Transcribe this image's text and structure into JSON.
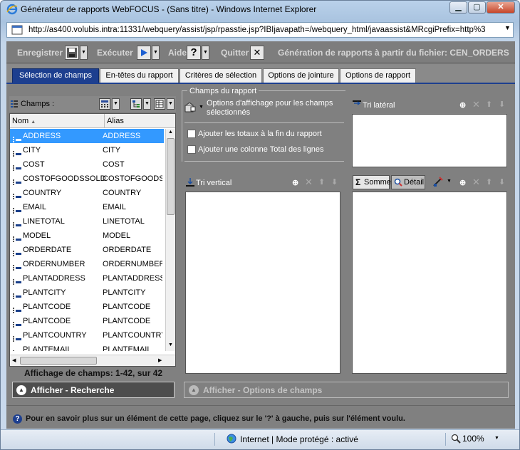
{
  "window": {
    "title": "Générateur de rapports WebFOCUS - (Sans titre) - Windows Internet Explorer",
    "address": "http://as400.volubis.intra:11331/webquery/assist/jsp/rpasstie.jsp?IBIjavapath=/webquery_html/javaassist&MRcgiPrefix=http%3"
  },
  "toolbar": {
    "save_label": "Enregistrer",
    "run_label": "Exécuter",
    "help_label": "Aide",
    "quit_label": "Quitter",
    "report_title": "Génération de rapports à partir du fichier: CEN_ORDERS"
  },
  "tabs": [
    {
      "label": "Sélection de champs",
      "active": true
    },
    {
      "label": "En-têtes du rapport",
      "active": false
    },
    {
      "label": "Critères de sélection",
      "active": false
    },
    {
      "label": "Options de jointure",
      "active": false
    },
    {
      "label": "Options de rapport",
      "active": false
    }
  ],
  "fields_panel": {
    "label": "Champs :",
    "col_name": "Nom",
    "col_alias": "Alias",
    "rows": [
      {
        "name": "ADDRESS",
        "alias": "ADDRESS",
        "selected": true
      },
      {
        "name": "CITY",
        "alias": "CITY"
      },
      {
        "name": "COST",
        "alias": "COST"
      },
      {
        "name": "COSTOFGOODSSOLD",
        "alias": "COSTOFGOODSS"
      },
      {
        "name": "COUNTRY",
        "alias": "COUNTRY"
      },
      {
        "name": "EMAIL",
        "alias": "EMAIL"
      },
      {
        "name": "LINETOTAL",
        "alias": "LINETOTAL"
      },
      {
        "name": "MODEL",
        "alias": "MODEL"
      },
      {
        "name": "ORDERDATE",
        "alias": "ORDERDATE"
      },
      {
        "name": "ORDERNUMBER",
        "alias": "ORDERNUMBER"
      },
      {
        "name": "PLANTADDRESS",
        "alias": "PLANTADDRESS"
      },
      {
        "name": "PLANTCITY",
        "alias": "PLANTCITY"
      },
      {
        "name": "PLANTCODE",
        "alias": "PLANTCODE"
      },
      {
        "name": "PLANTCODE",
        "alias": "PLANTCODE"
      },
      {
        "name": "PLANTCOUNTRY",
        "alias": "PLANTCOUNTRY"
      },
      {
        "name": "PLANTEMAIL",
        "alias": "PLANTEMAIL"
      }
    ],
    "count_text": "Affichage de champs: 1-42, sur 42",
    "search_button": "Afficher - Recherche"
  },
  "report_fields": {
    "label": "Champs du rapport",
    "display_options": "Options d'affichage pour les champs sélectionnés",
    "add_totals": "Ajouter les totaux à la fin du rapport",
    "add_total_column": "Ajouter une colonne Total des lignes",
    "lateral_sort": "Tri latéral",
    "vertical_sort": "Tri vertical",
    "sum_button": "Somme",
    "detail_button": "Détail",
    "field_options_button": "Afficher - Options de champs"
  },
  "help_text": "Pour en savoir plus sur un élément de cette page, cliquez sur le '?' à gauche, puis sur l'élément voulu.",
  "statusbar": {
    "zone": "Internet | Mode protégé : activé",
    "zoom": "100%"
  }
}
